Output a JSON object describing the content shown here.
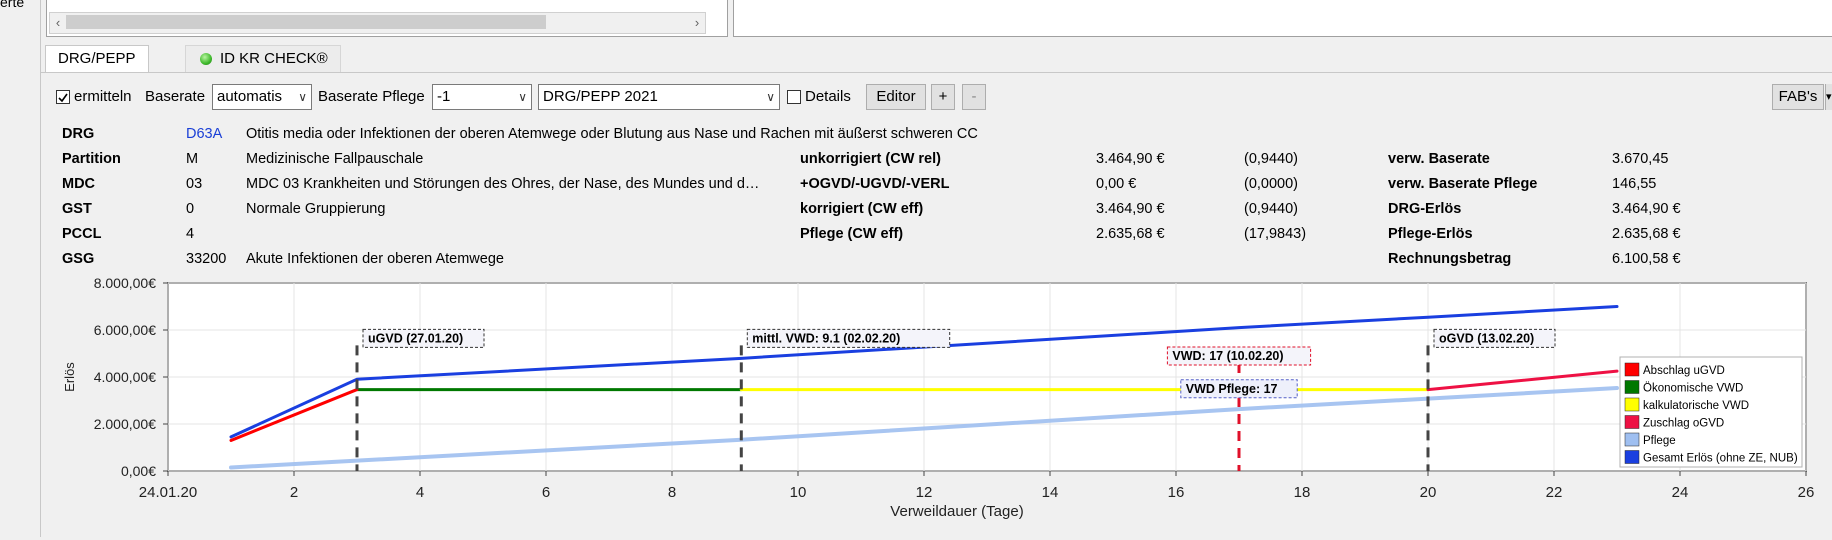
{
  "left_label": "erte",
  "tabs": [
    {
      "label": "DRG/PEPP",
      "active": true
    },
    {
      "label": "ID KR CHECK®",
      "active": false
    }
  ],
  "toolbar": {
    "ermitteln_label": "ermitteln",
    "ermitteln_checked": true,
    "baserate_label": "Baserate",
    "baserate_value": "automatis",
    "baserate_pflege_label": "Baserate Pflege",
    "baserate_pflege_value": "-1",
    "version_value": "DRG/PEPP 2021",
    "details_label": "Details",
    "details_checked": false,
    "editor_label": "Editor",
    "plus_label": "+",
    "minus_label": "-",
    "fabs_label": "FAB's"
  },
  "info": {
    "rows": [
      {
        "label": "DRG",
        "code": "D63A",
        "text": "Otitis media oder Infektionen der oberen Atemwege oder Blutung aus Nase und Rachen mit äußerst schweren CC"
      },
      {
        "label": "Partition",
        "code": "M",
        "text": "Medizinische Fallpauschale"
      },
      {
        "label": "MDC",
        "code": "03",
        "text": "MDC 03 Krankheiten und Störungen des Ohres, der Nase, des Mundes und d…"
      },
      {
        "label": "GST",
        "code": "0",
        "text": "Normale Gruppierung"
      },
      {
        "label": "PCCL",
        "code": "4",
        "text": ""
      },
      {
        "label": "GSG",
        "code": "33200",
        "text": "Akute Infektionen der oberen Atemwege"
      }
    ],
    "middle": [
      {
        "label": "unkorrigiert (CW rel)",
        "value": "3.464,90 €",
        "paren": "(0,9440)"
      },
      {
        "label": "+OGVD/-UGVD/-VERL",
        "value": "0,00 €",
        "paren": "(0,0000)"
      },
      {
        "label": "korrigiert (CW eff)",
        "value": "3.464,90 €",
        "paren": "(0,9440)"
      },
      {
        "label": "Pflege (CW eff)",
        "value": "2.635,68 €",
        "paren": "(17,9843)"
      }
    ],
    "right": [
      {
        "label": "verw. Baserate",
        "value": "3.670,45"
      },
      {
        "label": "verw. Baserate Pflege",
        "value": "146,55"
      },
      {
        "label": "DRG-Erlös",
        "value": "3.464,90 €"
      },
      {
        "label": "Pflege-Erlös",
        "value": "2.635,68 €"
      },
      {
        "label": "Rechnungsbetrag",
        "value": "6.100,58 €"
      }
    ]
  },
  "chart_data": {
    "type": "line",
    "xlabel": "Verweildauer (Tage)",
    "ylabel": "Erlös",
    "xlim": [
      0,
      26
    ],
    "ylim": [
      0,
      8000
    ],
    "xticks": [
      0,
      2,
      4,
      6,
      8,
      10,
      12,
      14,
      16,
      18,
      20,
      22,
      24,
      26
    ],
    "xtick_labels": [
      "24.01.20",
      "2",
      "4",
      "6",
      "8",
      "10",
      "12",
      "14",
      "16",
      "18",
      "20",
      "22",
      "24",
      "26"
    ],
    "yticks": [
      0,
      2000,
      4000,
      6000,
      8000
    ],
    "ytick_labels": [
      "0,00€",
      "2.000,00€",
      "4.000,00€",
      "6.000,00€",
      "8.000,00€"
    ],
    "grid": true,
    "legend_position": "bottom-right",
    "series": [
      {
        "name": "Abschlag uGVD",
        "color": "#ff0000",
        "x": [
          1,
          3
        ],
        "y": [
          1300,
          3465
        ]
      },
      {
        "name": "Ökonomische VWD",
        "color": "#007800",
        "x": [
          3,
          9.1
        ],
        "y": [
          3465,
          3465
        ]
      },
      {
        "name": "kalkulatorische VWD",
        "color": "#ffff00",
        "x": [
          9.1,
          20
        ],
        "y": [
          3465,
          3465
        ]
      },
      {
        "name": "Zuschlag oGVD",
        "color": "#ee1144",
        "x": [
          20,
          23
        ],
        "y": [
          3465,
          4250
        ]
      },
      {
        "name": "Pflege",
        "color": "#9fbff0",
        "x": [
          1,
          3,
          9.1,
          17,
          20,
          23
        ],
        "y": [
          150,
          440,
          1330,
          2635,
          3080,
          3530
        ]
      },
      {
        "name": "Gesamt Erlös (ohne ZE, NUB)",
        "color": "#1a3fe0",
        "x": [
          1,
          3,
          9.1,
          17,
          20,
          23
        ],
        "y": [
          1450,
          3905,
          4795,
          6100,
          6545,
          7000
        ]
      }
    ],
    "markers": [
      {
        "x": 3,
        "label": "uGVD (27.01.20)",
        "color": "#444444",
        "label_y": 5600,
        "label_side": "right"
      },
      {
        "x": 9.1,
        "label": "mittl. VWD: 9.1 (02.02.20)",
        "color": "#444444",
        "label_y": 5600,
        "label_side": "right"
      },
      {
        "x": 17,
        "label": "VWD: 17 (10.02.20)",
        "color": "#e0102a",
        "label_y": 4850,
        "label_side": "center"
      },
      {
        "x": 20,
        "label": "oGVD (13.02.20)",
        "color": "#444444",
        "label_y": 5600,
        "label_side": "right"
      }
    ],
    "annotations": [
      {
        "x": 17,
        "y": 3500,
        "label": "VWD Pflege: 17"
      }
    ]
  }
}
